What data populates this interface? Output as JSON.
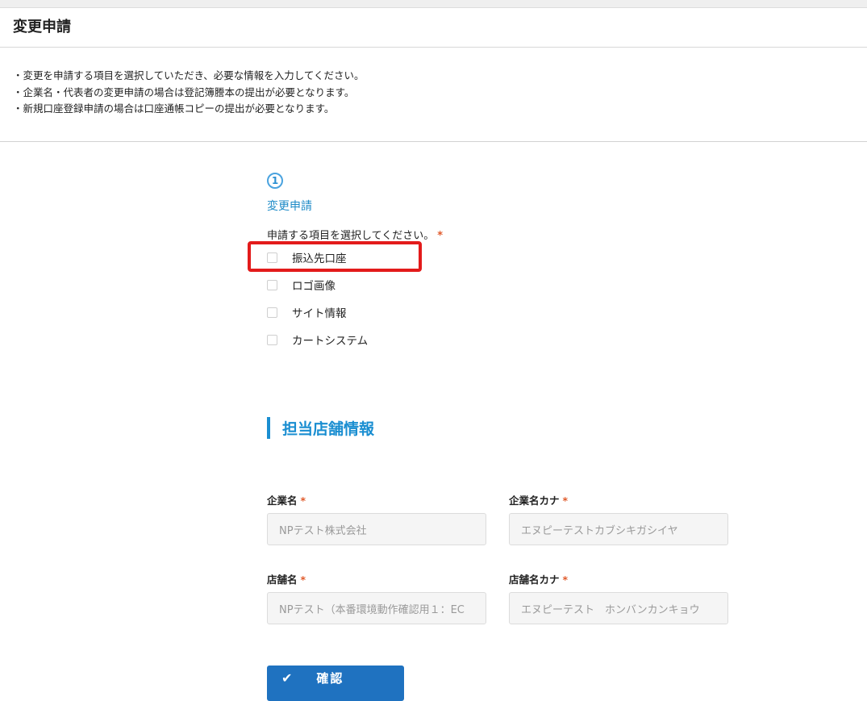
{
  "header": {
    "title": "変更申請"
  },
  "notes": [
    "・変更を申請する項目を選択していただき、必要な情報を入力してください。",
    "・企業名・代表者の変更申請の場合は登記簿謄本の提出が必要となります。",
    "・新規口座登録申請の場合は口座通帳コピーの提出が必要となります。"
  ],
  "step": {
    "number": "1",
    "label": "変更申請"
  },
  "question": {
    "text": "申請する項目を選択してください。",
    "required_mark": "*"
  },
  "options": [
    {
      "label": "振込先口座",
      "checked": false
    },
    {
      "label": "ロゴ画像",
      "checked": false
    },
    {
      "label": "サイト情報",
      "checked": false
    },
    {
      "label": "カートシステム",
      "checked": false
    }
  ],
  "section": {
    "title": "担当店舗情報"
  },
  "fields": {
    "company_name": {
      "label": "企業名",
      "required_mark": "*",
      "value": "NPテスト株式会社"
    },
    "company_kana": {
      "label": "企業名カナ",
      "required_mark": "*",
      "value": "エヌピーテストカブシキガシイヤ"
    },
    "store_name": {
      "label": "店舗名",
      "required_mark": "*",
      "value": "NPテスト（本番環境動作確認用１：EC"
    },
    "store_kana": {
      "label": "店舗名カナ",
      "required_mark": "*",
      "value": "エヌピーテスト　ホンバンカンキョウ"
    }
  },
  "confirm": {
    "icon": "check-icon",
    "glyph": "✔",
    "label": "確認"
  },
  "colors": {
    "accent": "#1a8ed1",
    "required": "#e05a2b",
    "highlight": "#e31b1b",
    "button": "#1f72c0"
  }
}
